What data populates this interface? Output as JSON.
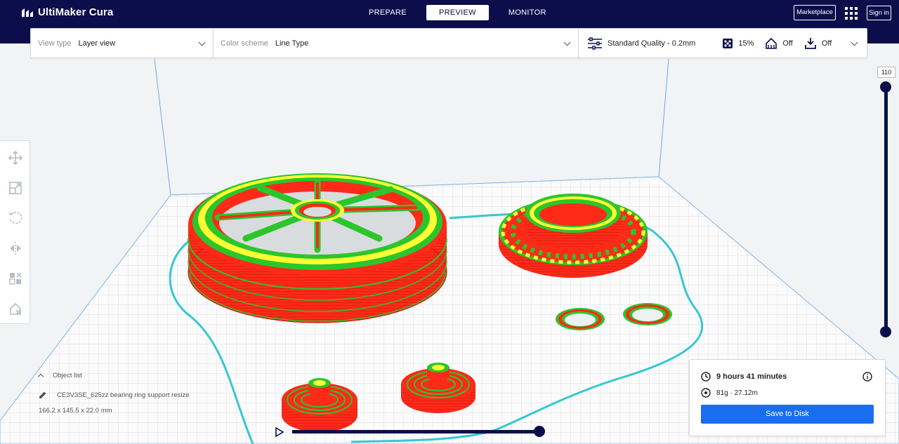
{
  "app": {
    "name": "UltiMaker Cura"
  },
  "stages": [
    "PREPARE",
    "PREVIEW",
    "MONITOR"
  ],
  "active_stage": "PREVIEW",
  "header": {
    "marketplace": "Marketplace",
    "sign_in": "Sign in"
  },
  "view": {
    "view_type_label": "View type",
    "view_type_value": "Layer view",
    "color_scheme_label": "Color scheme",
    "color_scheme_value": "Line Type"
  },
  "print_setup": {
    "profile": "Standard Quality - 0.2mm",
    "infill": "15%",
    "support": "Off",
    "adhesion": "Off"
  },
  "layers": {
    "current": "110"
  },
  "object_list": {
    "title": "Object list",
    "object_name": "CE3V3SE_625zz bearing ring support resize",
    "dimensions": "166.2 x 145.5 x 22.0 mm"
  },
  "print_info": {
    "time": "9 hours 41 minutes",
    "material": "81g · 27.12m",
    "save_label": "Save to Disk"
  },
  "colors": {
    "header": "#0b0e4b",
    "accent": "#196ef0",
    "wall_outer": "#ff2a18",
    "wall_inner": "#2bc62b",
    "top_skin": "#ffff33",
    "skirt": "#35c8d0"
  }
}
